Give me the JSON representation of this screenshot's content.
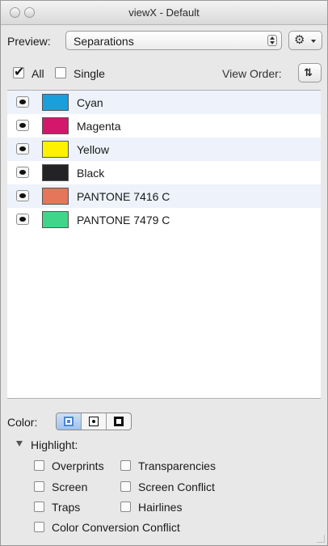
{
  "window": {
    "title": "viewX - Default"
  },
  "toolbar": {
    "preview_label": "Preview:",
    "preview_value": "Separations",
    "gear_icon": "gear-icon"
  },
  "filters": {
    "all_label": "All",
    "all_checked": true,
    "single_label": "Single",
    "single_checked": false,
    "view_order_label": "View Order:"
  },
  "separations": [
    {
      "name": "Cyan",
      "color": "#1a9fdd",
      "visible": true
    },
    {
      "name": "Magenta",
      "color": "#d4166d",
      "visible": true
    },
    {
      "name": "Yellow",
      "color": "#fff200",
      "visible": true
    },
    {
      "name": "Black",
      "color": "#232325",
      "visible": true
    },
    {
      "name": "PANTONE 7416 C",
      "color": "#e6765a",
      "visible": true
    },
    {
      "name": "PANTONE 7479 C",
      "color": "#3fd68a",
      "visible": true
    }
  ],
  "bottom_panel": {
    "color_label": "Color:",
    "color_modes_selected": 0,
    "highlight_label": "Highlight:",
    "options": {
      "overprints": "Overprints",
      "transparencies": "Transparencies",
      "screen": "Screen",
      "screen_conflict": "Screen Conflict",
      "traps": "Traps",
      "hairlines": "Hairlines",
      "color_conversion_conflict": "Color Conversion Conflict"
    }
  }
}
